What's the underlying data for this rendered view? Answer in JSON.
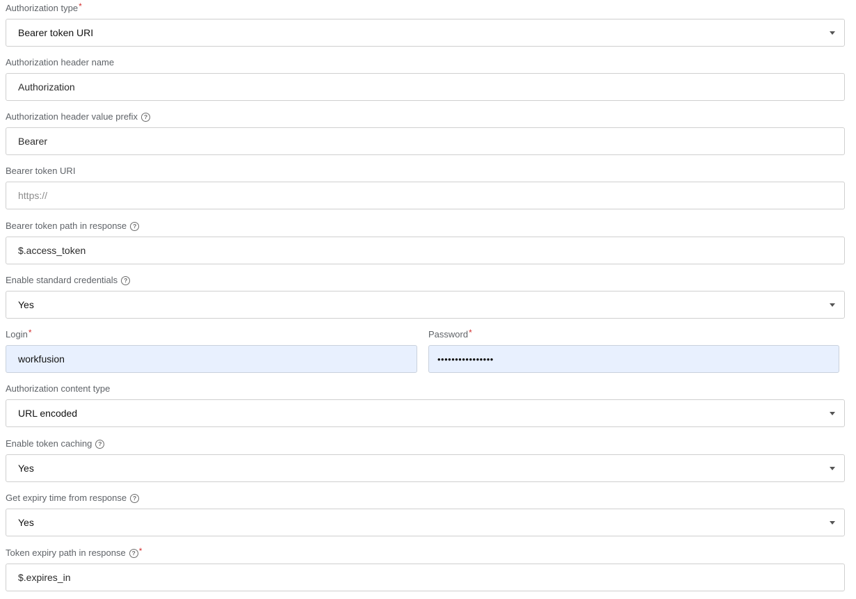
{
  "fields": {
    "auth_type": {
      "label": "Authorization type",
      "required": "*",
      "value": "Bearer token URI"
    },
    "header_name": {
      "label": "Authorization header name",
      "value": "Authorization"
    },
    "header_prefix": {
      "label": "Authorization header value prefix",
      "help": "?",
      "value": "Bearer"
    },
    "token_uri": {
      "label": "Bearer token URI",
      "placeholder": "https://"
    },
    "token_path": {
      "label": "Bearer token path in response",
      "help": "?",
      "value": "$.access_token"
    },
    "std_creds": {
      "label": "Enable standard credentials",
      "help": "?",
      "value": "Yes"
    },
    "login": {
      "label": "Login",
      "required": "*",
      "value": "workfusion"
    },
    "password": {
      "label": "Password",
      "required": "*",
      "value": "••••••••••••••••"
    },
    "content_type": {
      "label": "Authorization content type",
      "value": "URL encoded"
    },
    "token_caching": {
      "label": "Enable token caching",
      "help": "?",
      "value": "Yes"
    },
    "expiry_from_response": {
      "label": "Get expiry time from response",
      "help": "?",
      "value": "Yes"
    },
    "expiry_path": {
      "label": "Token expiry path in response",
      "help": "?",
      "required": "*",
      "value": "$.expires_in"
    }
  },
  "icons": {
    "help": "question-circle-icon",
    "caret": "caret-down-icon"
  },
  "colors": {
    "required": "#d32f2f",
    "autofill_bg": "#e8f0fe",
    "border": "#cfcfcf",
    "label": "#5f6368"
  }
}
